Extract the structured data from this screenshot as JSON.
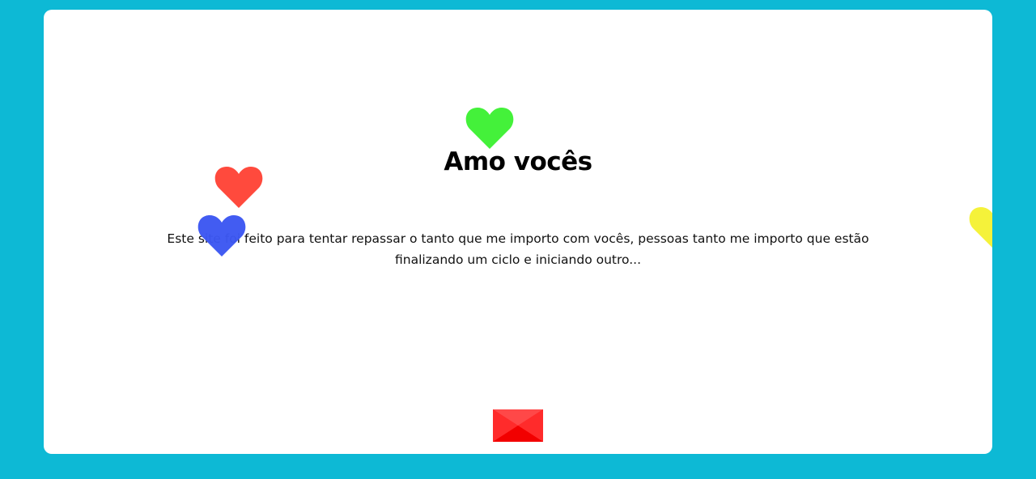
{
  "page": {
    "title": "Amo vocês",
    "message": "Este site foi feito para tentar repassar o tanto que me importo com vocês, pessoas tanto me importo que estão finalizando um ciclo e iniciando outro..."
  },
  "colors": {
    "background": "#0db9d5",
    "card": "#ffffff",
    "heart_green": "#44f13a",
    "heart_red": "#ff4a3d",
    "heart_blue": "#3c57f2",
    "heart_yellow": "#f5f23a",
    "envelope": "#ff0000"
  },
  "icons": {
    "hearts": [
      "heart-icon-green",
      "heart-icon-red",
      "heart-icon-blue",
      "heart-icon-yellow"
    ],
    "envelope": "envelope-icon"
  }
}
